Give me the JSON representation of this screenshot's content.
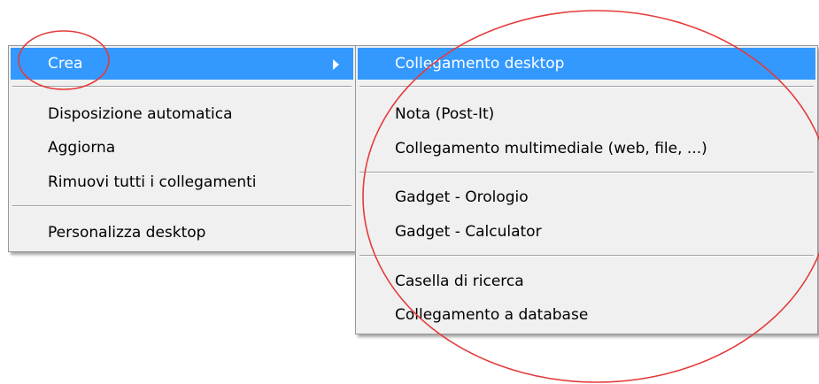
{
  "main_menu": {
    "items": [
      {
        "label": "Crea",
        "has_submenu": true,
        "selected": true
      },
      {
        "label": "Disposizione automatica"
      },
      {
        "label": "Aggiorna"
      },
      {
        "label": "Rimuovi tutti i collegamenti"
      },
      {
        "label": "Personalizza desktop"
      }
    ]
  },
  "sub_menu": {
    "items": [
      {
        "label": "Collegamento desktop",
        "selected": true
      },
      {
        "label": "Nota (Post-It)"
      },
      {
        "label": "Collegamento multimediale (web, file, ...)"
      },
      {
        "label": "Gadget - Orologio"
      },
      {
        "label": "Gadget - Calculator"
      },
      {
        "label": "Casella di ricerca"
      },
      {
        "label": "Collegamento a database"
      }
    ]
  },
  "colors": {
    "menu_bg": "#f0f0f0",
    "highlight": "#3399ff",
    "annotation": "#e53a3a"
  },
  "annotations": [
    "red-circle-crea",
    "red-circle-submenu"
  ]
}
